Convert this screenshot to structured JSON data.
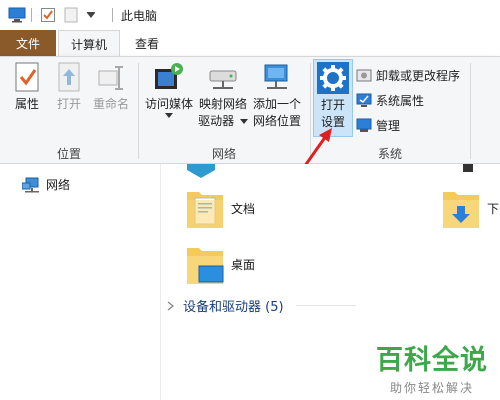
{
  "window": {
    "title": "此电脑"
  },
  "tabs": {
    "file": "文件",
    "computer": "计算机",
    "view": "查看"
  },
  "ribbon": {
    "location": {
      "label": "位置",
      "properties": "属性",
      "open": "打开",
      "rename": "重命名"
    },
    "network": {
      "label": "网络",
      "access_media": "访问媒体",
      "map_drive_line1": "映射网络",
      "map_drive_line2": "驱动器",
      "add_location_line1": "添加一个",
      "add_location_line2": "网络位置"
    },
    "system": {
      "label": "系统",
      "open_settings_line1": "打开",
      "open_settings_line2": "设置",
      "uninstall": "卸载或更改程序",
      "system_properties": "系统属性",
      "manage": "管理"
    }
  },
  "nav": {
    "network": "网络"
  },
  "content": {
    "documents": "文档",
    "desktop": "桌面",
    "downloads": "下",
    "devices_section": "设备和驱动器 (5)"
  },
  "watermark": {
    "main": "百科全说",
    "sub": "助你轻松解决"
  },
  "colors": {
    "file_tab": "#8a5a2b",
    "accent_blue": "#1e73c8",
    "arrow": "#e02020",
    "watermark": "#3da84a"
  }
}
